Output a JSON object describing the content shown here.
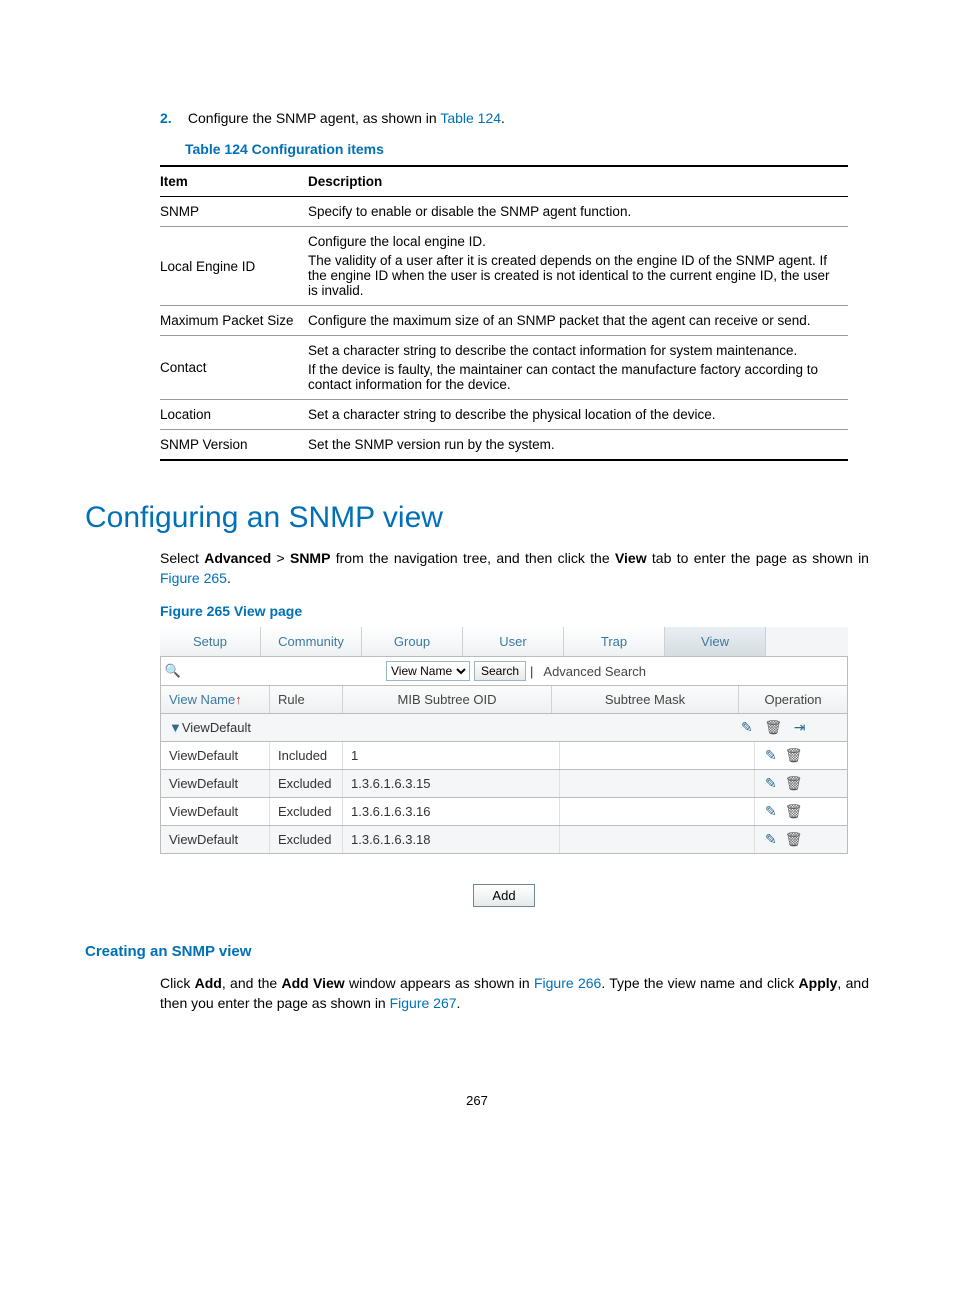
{
  "step": {
    "num": "2.",
    "pre": "Configure the SNMP agent, as shown in ",
    "link": "Table 124",
    "post": "."
  },
  "table_caption": "Table 124 Configuration items",
  "table_headers": {
    "item": "Item",
    "desc": "Description"
  },
  "table_rows": [
    {
      "item": "SNMP",
      "lines": [
        "Specify to enable or disable the SNMP agent function."
      ]
    },
    {
      "item": "Local Engine ID",
      "lines": [
        "Configure the local engine ID.",
        "The validity of a user after it is created depends on the engine ID of the SNMP agent. If the engine ID when the user is created is not identical to the current engine ID, the user is invalid."
      ]
    },
    {
      "item": "Maximum Packet Size",
      "lines": [
        "Configure the maximum size of an SNMP packet that the agent can receive or send."
      ]
    },
    {
      "item": "Contact",
      "lines": [
        "Set a character string to describe the contact information for system maintenance.",
        "If the device is faulty, the maintainer can contact the manufacture factory according to contact information for the device."
      ]
    },
    {
      "item": "Location",
      "lines": [
        "Set a character string to describe the physical location of the device."
      ]
    },
    {
      "item": "SNMP Version",
      "lines": [
        "Set the SNMP version run by the system."
      ]
    }
  ],
  "h1": "Configuring an SNMP view",
  "intro": {
    "p1a": "Select ",
    "b1": "Advanced",
    "p1b": " > ",
    "b2": "SNMP",
    "p1c": " from the navigation tree, and then click the ",
    "b3": "View",
    "p1d": " tab to enter the page as shown in ",
    "link": "Figure 265",
    "p1e": "."
  },
  "figure_caption": "Figure 265 View page",
  "tabs": [
    "Setup",
    "Community",
    "Group",
    "User",
    "Trap",
    "View"
  ],
  "active_tab_index": 5,
  "search": {
    "dropdown_label": "View Name",
    "button": "Search",
    "advanced": "Advanced Search"
  },
  "grid": {
    "headers": {
      "vn": "View Name",
      "sort": "↑",
      "rule": "Rule",
      "oid": "MIB Subtree OID",
      "mask": "Subtree Mask",
      "op": "Operation"
    },
    "group_row": {
      "name": "ViewDefault"
    },
    "rows": [
      {
        "vn": "ViewDefault",
        "rule": "Included",
        "oid": "1",
        "mask": ""
      },
      {
        "vn": "ViewDefault",
        "rule": "Excluded",
        "oid": "1.3.6.1.6.3.15",
        "mask": ""
      },
      {
        "vn": "ViewDefault",
        "rule": "Excluded",
        "oid": "1.3.6.1.6.3.16",
        "mask": ""
      },
      {
        "vn": "ViewDefault",
        "rule": "Excluded",
        "oid": "1.3.6.1.6.3.18",
        "mask": ""
      }
    ]
  },
  "add_button": "Add",
  "subheading": "Creating an SNMP view",
  "create_text": {
    "a": "Click ",
    "b1": "Add",
    "b": ", and the ",
    "b2": "Add View",
    "c": " window appears as shown in ",
    "l1": "Figure 266",
    "d": ". Type the view name and click ",
    "b3": "Apply",
    "e": ", and then you enter the page as shown in ",
    "l2": "Figure 267",
    "f": "."
  },
  "page_number": "267",
  "chart_data": {
    "type": "table",
    "title": "SNMP View list",
    "columns": [
      "View Name",
      "Rule",
      "MIB Subtree OID",
      "Subtree Mask"
    ],
    "rows": [
      [
        "ViewDefault",
        "Included",
        "1",
        ""
      ],
      [
        "ViewDefault",
        "Excluded",
        "1.3.6.1.6.3.15",
        ""
      ],
      [
        "ViewDefault",
        "Excluded",
        "1.3.6.1.6.3.16",
        ""
      ],
      [
        "ViewDefault",
        "Excluded",
        "1.3.6.1.6.3.18",
        ""
      ]
    ]
  }
}
